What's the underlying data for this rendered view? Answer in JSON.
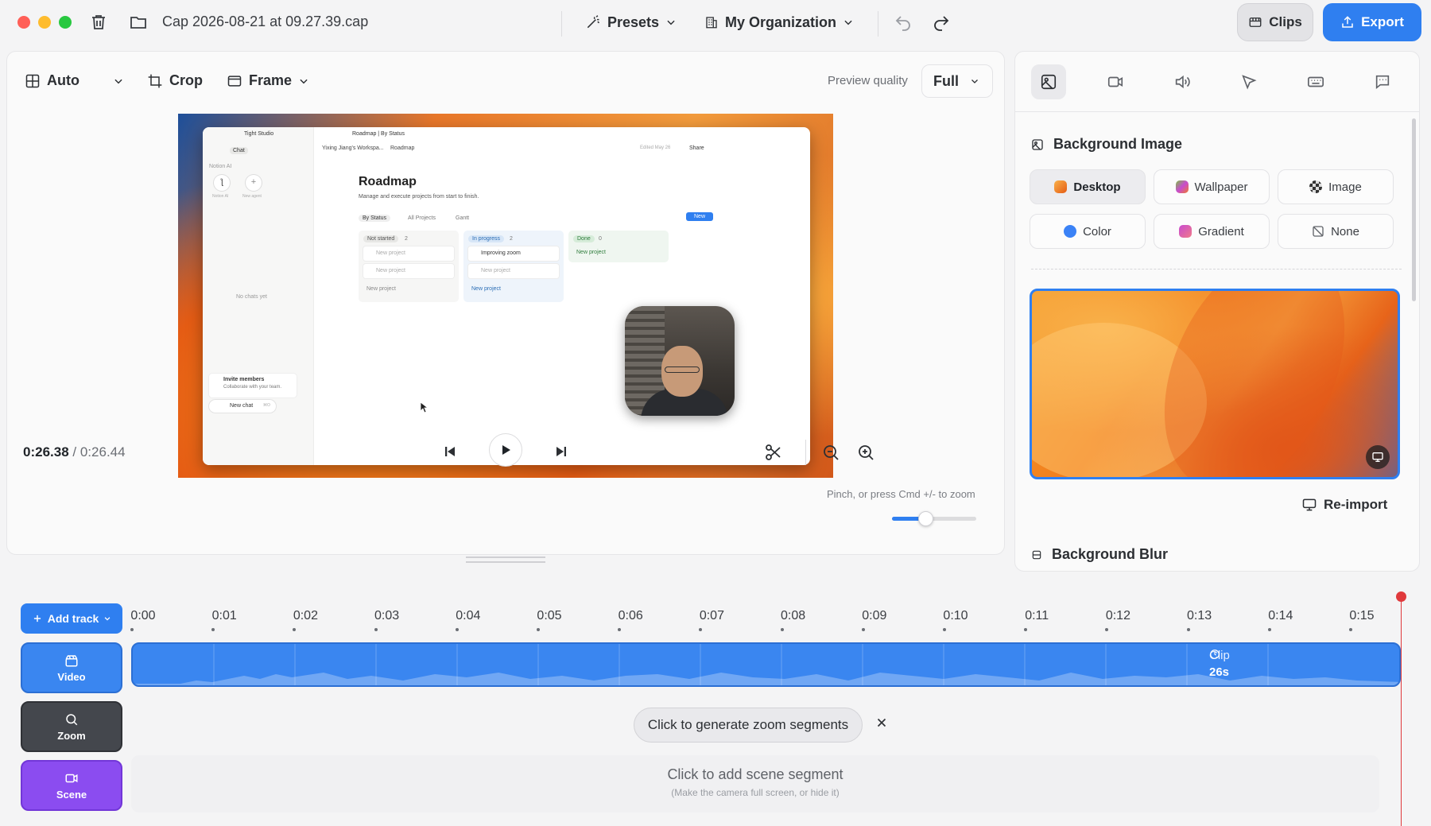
{
  "titlebar": {
    "file_title": "Cap 2026-08-21 at 09.27.39.cap",
    "presets_label": "Presets",
    "org_label": "My Organization",
    "clips_label": "Clips",
    "export_label": "Export"
  },
  "toolbar": {
    "layout_label": "Auto",
    "crop_label": "Crop",
    "frame_label": "Frame",
    "preview_quality_label": "Preview quality",
    "preview_quality_value": "Full"
  },
  "preview": {
    "app_name": "Tight Studio",
    "tab_title": "Roadmap | By Status",
    "breadcrumb_workspace": "Yixing Jiang's Workspa...",
    "breadcrumb_page": "Roadmap",
    "edited": "Edited May 26",
    "share": "Share",
    "sidebar_chat": "Chat",
    "sidebar_notion_ai": "Notion AI",
    "sidebar_new_agent": "New agent",
    "no_chats": "No chats yet",
    "invite_title": "Invite members",
    "invite_sub": "Collaborate with your team.",
    "new_chat": "New chat",
    "new_chat_shortcut": "⌘O",
    "page_title": "Roadmap",
    "page_subtitle": "Manage and execute projects from start to finish.",
    "views": [
      "By Status",
      "All Projects",
      "Gantt"
    ],
    "new_button": "New",
    "columns": [
      {
        "name": "Not started",
        "count": "2",
        "cards": [
          "New project",
          "New project"
        ],
        "add": "New project"
      },
      {
        "name": "In progress",
        "count": "2",
        "cards": [
          "Improving zoom",
          "New project"
        ],
        "add": "New project"
      },
      {
        "name": "Done",
        "count": "0",
        "cards": [],
        "add": "New project"
      }
    ]
  },
  "playback": {
    "current_time": "0:26.38",
    "total_time": "/ 0:26.44",
    "zoom_hint": "Pinch, or press Cmd +/- to zoom",
    "zoom_level": 0.4
  },
  "right_panel": {
    "tabs": [
      "background-tab",
      "camera-tab",
      "audio-tab",
      "cursor-tab",
      "keyboard-tab",
      "captions-tab"
    ],
    "background_image_title": "Background Image",
    "options": [
      {
        "label": "Desktop",
        "color": "#f07a2a"
      },
      {
        "label": "Wallpaper",
        "color": "#7bc043"
      },
      {
        "label": "Image",
        "color": "#333333"
      },
      {
        "label": "Color",
        "color": "#3b82f6"
      },
      {
        "label": "Gradient",
        "color": "#c94bd0"
      },
      {
        "label": "None",
        "color": "#888888"
      }
    ],
    "reimport_label": "Re-import",
    "background_blur_title": "Background Blur"
  },
  "timeline": {
    "add_track_label": "Add track",
    "ticks": [
      "0:00",
      "0:01",
      "0:02",
      "0:03",
      "0:04",
      "0:05",
      "0:06",
      "0:07",
      "0:08",
      "0:09",
      "0:10",
      "0:11",
      "0:12",
      "0:13",
      "0:14",
      "0:15"
    ],
    "tracks": {
      "video": "Video",
      "zoom": "Zoom",
      "scene": "Scene"
    },
    "clip_label": "Clip",
    "clip_duration": "26s",
    "generate_zoom_label": "Click to generate zoom segments",
    "scene_title": "Click to add scene segment",
    "scene_subtitle": "(Make the camera full screen, or hide it)"
  },
  "colors": {
    "accent": "#2f7ff0",
    "playhead": "#e0393c",
    "scene_track": "#8b4cf0",
    "zoom_track": "#44474d"
  }
}
